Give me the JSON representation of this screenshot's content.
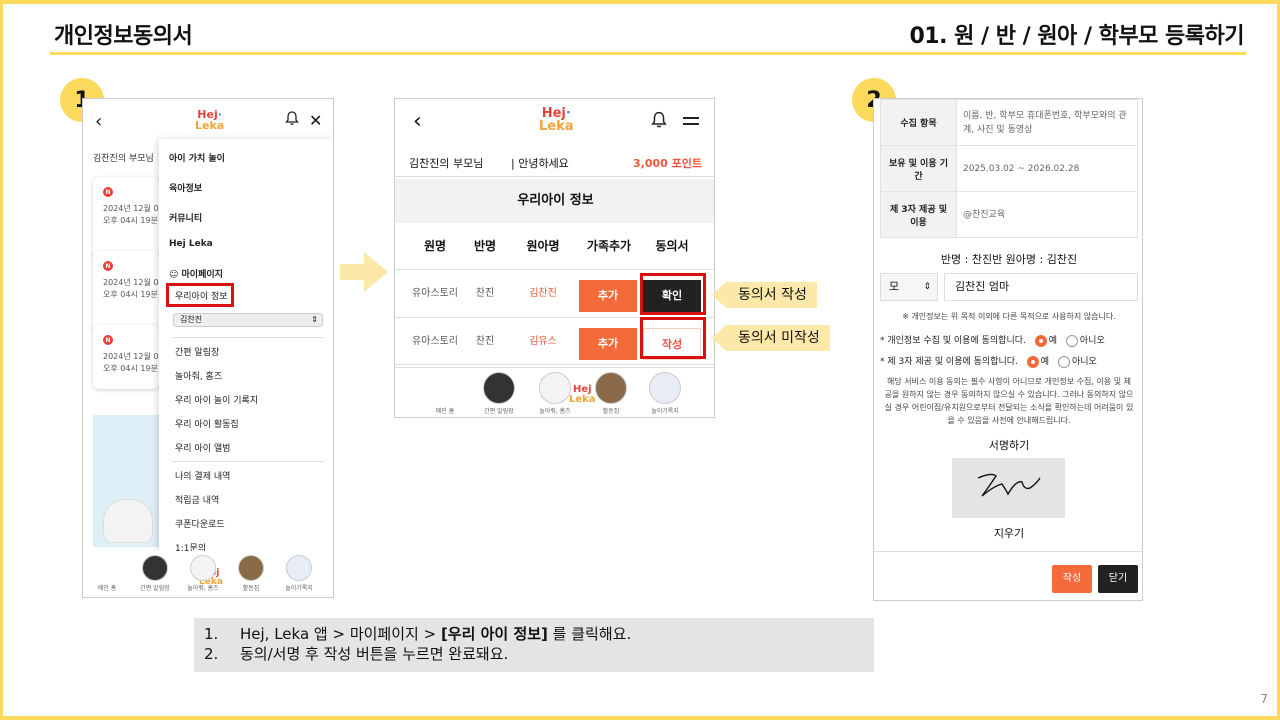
{
  "header": {
    "title": "개인정보동의서",
    "section": "01. 원 / 반 / 원아 / 학부모 등록하기"
  },
  "steps": [
    "1",
    "2"
  ],
  "page_number": "7",
  "brand": {
    "logo_line1": "Hej",
    "logo_dot": "·",
    "logo_line2": "Leka"
  },
  "screen1": {
    "parent": "김찬진의 부모님",
    "cards": [
      {
        "badge": "N",
        "line1": "2024년 12월 04",
        "line2": "오후 04시 19분"
      },
      {
        "badge": "N",
        "line1": "2024년 12월 04",
        "line2": "오후 04시 19분"
      },
      {
        "badge": "N",
        "line1": "2024년 12월 04",
        "line2": "오후 04시 19분"
      }
    ],
    "drawer": {
      "items_top": [
        "아이 가치 놀이",
        "육아정보",
        "커뮤니티",
        "Hej Leka"
      ],
      "mypage": "마이페이지",
      "child_info": "우리아이 정보",
      "child_select": "김찬진",
      "items_mid": [
        "간편 알림장",
        "놀아줘, 홈즈",
        "우리 아이 놀이 기록지",
        "우리 아이 활동집",
        "우리 아이 앨범"
      ],
      "items_bot": [
        "나의 결제 내역",
        "적립금 내역",
        "쿠폰다운로드",
        "1:1문의"
      ]
    },
    "tabs": [
      "메인 홈",
      "간편 알림장",
      "놀아줘, 홈즈",
      "활동집",
      "놀이기록지"
    ]
  },
  "screen2": {
    "parent": "김찬진의 부모님",
    "greeting": "안녕하세요",
    "points": "3,000 포인트",
    "title": "우리아이 정보",
    "columns": [
      "원명",
      "반명",
      "원아명",
      "가족추가",
      "동의서"
    ],
    "rows": [
      {
        "school": "유아스토리",
        "class": "찬진",
        "child": "김찬진",
        "add": "추가",
        "consent": "확인"
      },
      {
        "school": "유아스토리",
        "class": "찬진",
        "child": "김유스",
        "add": "추가",
        "consent": "작성"
      }
    ],
    "tabs": [
      "메인 홈",
      "간편 알림장",
      "놀아줘, 홈즈",
      "활동집",
      "놀이기록지"
    ],
    "callouts": [
      "동의서 작성",
      "동의서 미작성"
    ]
  },
  "screen3": {
    "table": [
      {
        "label": "수집 항목",
        "value": "이름, 반, 학부모 휴대폰번호, 학부모와의 관계, 사진 및 동영상"
      },
      {
        "label": "보유 및 이용 기간",
        "value": "2025.03.02 ~ 2026.02.28"
      },
      {
        "label": "제 3자 제공 및 이용",
        "value": "@찬진교육"
      }
    ],
    "class_line": "반명 : 찬진반  원아명 : 김찬진",
    "relation": "모",
    "name_value": "김찬진 엄마",
    "note": "※ 개인정보는 위 목적 이외에 다른 목적으로 사용하지 않습니다.",
    "agree1": "* 개인정보 수집 및 이용에 동의합니다.",
    "agree2": "* 제 3자 제공 및 이용에 동의합니다.",
    "yes": "예",
    "no": "아니오",
    "paragraph": "해당 서비스 이용 동의는 필수 사항이 아니므로 개인정보 수집, 이용 및 제공을 원하지 않는 경우 동의하지 않으실 수 있습니다. 그러나 동의하지 않으실 경우 어린이집/유치원으로부터 전달되는 소식을 확인하는데 어려움이 있을 수 있음을 사전에 안내해드립니다.",
    "sign_title": "서명하기",
    "clear": "지우기",
    "write_button": "작성",
    "close_button": "닫기"
  },
  "instructions": [
    {
      "num": "1.",
      "pre": "Hej, Leka 앱 > 마이페이지 > ",
      "bold": "[우리 아이 정보]",
      "post": " 를 클릭해요."
    },
    {
      "num": "2.",
      "text": "동의/서명 후 작성 버튼을 누르면 완료돼요."
    }
  ],
  "colors": {
    "accent_yellow": "#fbd95c",
    "orange": "#f46a3a",
    "highlight_red": "#d91010",
    "dark": "#222222"
  }
}
